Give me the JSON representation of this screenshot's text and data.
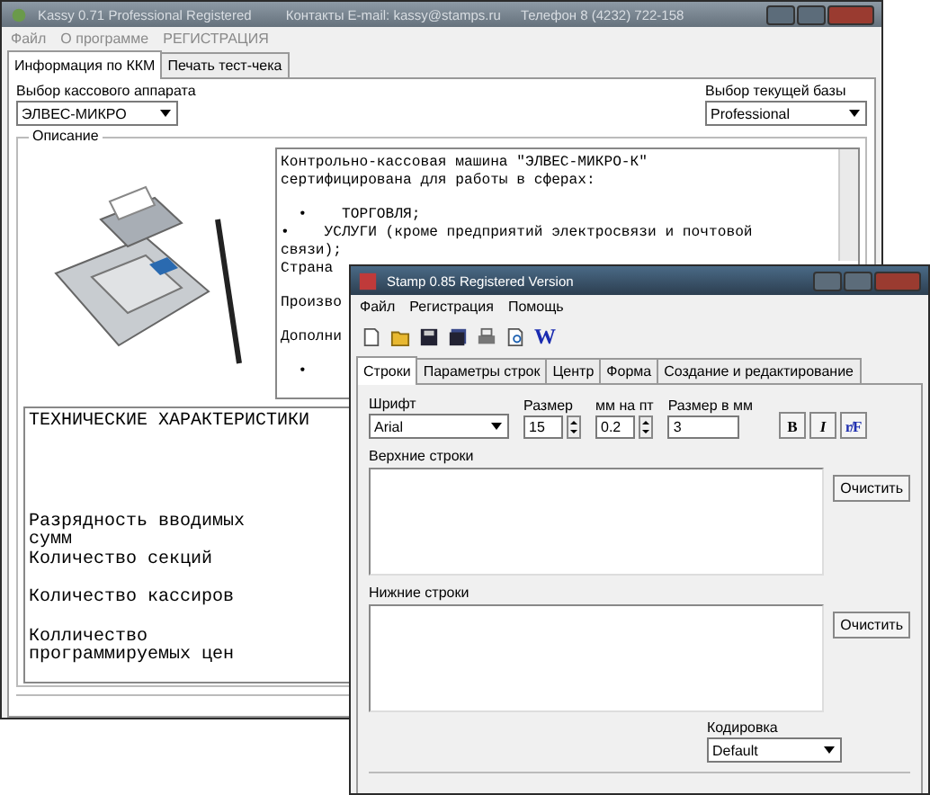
{
  "kassy_window": {
    "title": "Kassy 0.71 Professional Registered",
    "contacts": "Контакты E-mail: kassy@stamps.ru",
    "phone": "Телефон 8 (4232) 722-158",
    "menu": [
      "Файл",
      "О программе",
      "РЕГИСТРАЦИЯ"
    ],
    "tabs": [
      {
        "label": "Информация по ККМ",
        "selected": true
      },
      {
        "label": "Печать тест-чека",
        "selected": false
      }
    ],
    "device_label": "Выбор кассового аппарата",
    "device_value": "ЭЛВЕС-МИКРО",
    "base_label": "Выбор текущей базы",
    "base_value": "Professional",
    "group_title": "Описание",
    "description": [
      [
        "Контрольно-кассовая машина \"ЭЛВЕС-МИКРО-К\"",
        "сертифицирована для работы в сферах:"
      ],
      [
        "  •    ТОРГОВЛЯ;",
        "•    УСЛУГИ (кроме предприятий электросвязи и почтовой",
        "связи);",
        "Страна"
      ],
      [
        "Произво"
      ],
      [
        "Дополни"
      ],
      [
        "  •"
      ]
    ],
    "specs_title": "ТЕХНИЧЕСКИЕ ХАРАКТЕРИСТИКИ",
    "specs": [
      [
        "Разрядность вводимых",
        "сумм",
        "Количество секций"
      ],
      [
        "Количество кассиров"
      ],
      [
        "Колличество",
        "программируемых цен"
      ]
    ]
  },
  "stamp_window": {
    "title": "Stamp 0.85 Registered Version",
    "menu": [
      "Файл",
      "Регистрация",
      "Помощь"
    ],
    "toolbar_letter": "W",
    "tabs": [
      {
        "label": "Строки",
        "selected": true
      },
      {
        "label": "Параметры строк",
        "selected": false
      },
      {
        "label": "Центр",
        "selected": false
      },
      {
        "label": "Форма",
        "selected": false
      },
      {
        "label": "Создание и редактирование",
        "selected": false
      }
    ],
    "font_label": "Шрифт",
    "font_value": "Arial",
    "size_label": "Размер",
    "size_value": "15",
    "mm_label": "мм на пт",
    "mm_value": "0.2",
    "size_mm_label": "Размер в мм",
    "size_mm_value": "3",
    "style_buttons": [
      {
        "kind": "bold",
        "label": "B"
      },
      {
        "kind": "italic",
        "label": "I"
      },
      {
        "kind": "rf",
        "label": "r/F"
      }
    ],
    "top_label": "Верхние строки",
    "bottom_label": "Нижние строки",
    "clear_button": "Очистить",
    "clear_button_2": "Очистить",
    "encoding_label": "Кодировка",
    "encoding_value": "Default"
  }
}
